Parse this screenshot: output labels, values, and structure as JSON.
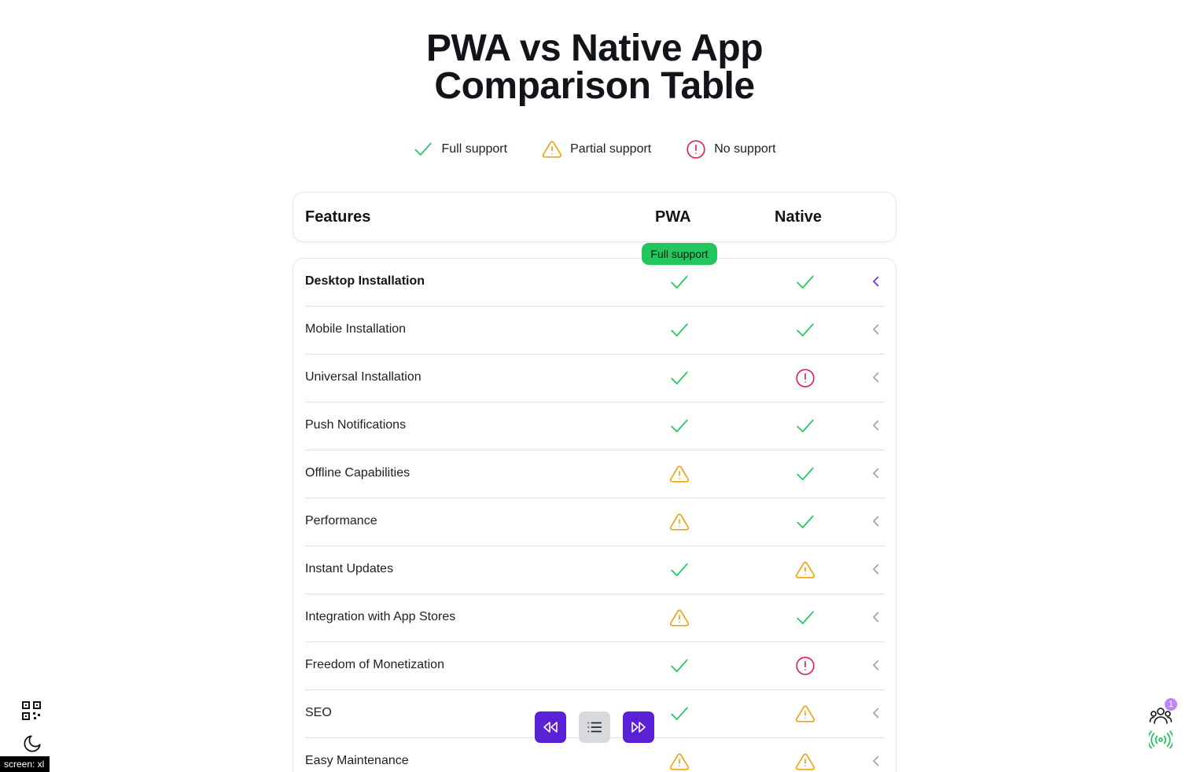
{
  "title": {
    "line1": "PWA vs Native App",
    "line2": "Comparison Table"
  },
  "legend": [
    {
      "icon": "check-icon",
      "label": "Full support"
    },
    {
      "icon": "warning-icon",
      "label": "Partial support"
    },
    {
      "icon": "no-support-icon",
      "label": "No support"
    }
  ],
  "header": {
    "features": "Features",
    "pwa": "PWA",
    "native": "Native"
  },
  "tooltip": "Full support",
  "rows": [
    {
      "feature": "Desktop Installation",
      "pwa": "full",
      "native": "full"
    },
    {
      "feature": "Mobile Installation",
      "pwa": "full",
      "native": "full"
    },
    {
      "feature": "Universal Installation",
      "pwa": "full",
      "native": "none"
    },
    {
      "feature": "Push Notifications",
      "pwa": "full",
      "native": "full"
    },
    {
      "feature": "Offline Capabilities",
      "pwa": "partial",
      "native": "full"
    },
    {
      "feature": "Performance",
      "pwa": "partial",
      "native": "full"
    },
    {
      "feature": "Instant Updates",
      "pwa": "full",
      "native": "partial"
    },
    {
      "feature": "Integration with App Stores",
      "pwa": "partial",
      "native": "full"
    },
    {
      "feature": "Freedom of Monetization",
      "pwa": "full",
      "native": "none"
    },
    {
      "feature": "SEO",
      "pwa": "full",
      "native": "partial"
    },
    {
      "feature": "Easy Maintenance",
      "pwa": "partial",
      "native": "partial"
    }
  ],
  "colors": {
    "full": "#22c55e",
    "partial": "#f59e0b",
    "none": "#e11d48",
    "accent": "#5b21d6",
    "chevron_active": "#6d28d9",
    "chevron": "#9ca3af"
  },
  "footer": {
    "screen_badge": "screen: xl",
    "users_count": "1"
  }
}
